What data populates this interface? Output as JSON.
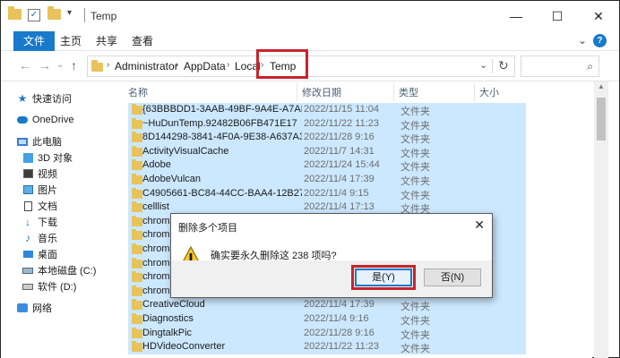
{
  "window": {
    "title": "Temp",
    "controls": {
      "minimize": "—",
      "maximize": "☐",
      "close": "✕"
    }
  },
  "ribbon": {
    "tabs": [
      "文件",
      "主页",
      "共享",
      "查看"
    ],
    "help": "?"
  },
  "nav": {
    "back": "←",
    "forward": "→",
    "dropdown": "⌄",
    "up": "↑",
    "breadcrumb": [
      "Administrator",
      "AppData",
      "Local",
      "Temp"
    ],
    "separator": "›",
    "search_placeholder": ""
  },
  "sidebar": {
    "items": [
      {
        "label": "快速访问",
        "icon": "star-icon"
      },
      {
        "label": "OneDrive",
        "icon": "cloud-icon"
      },
      {
        "label": "此电脑",
        "icon": "pc-icon"
      },
      {
        "label": "3D 对象",
        "icon": "cube-icon"
      },
      {
        "label": "视频",
        "icon": "video-icon"
      },
      {
        "label": "图片",
        "icon": "picture-icon"
      },
      {
        "label": "文档",
        "icon": "document-icon"
      },
      {
        "label": "下载",
        "icon": "download-icon"
      },
      {
        "label": "音乐",
        "icon": "music-icon"
      },
      {
        "label": "桌面",
        "icon": "desktop-icon"
      },
      {
        "label": "本地磁盘 (C:)",
        "icon": "drive-icon"
      },
      {
        "label": "软件 (D:)",
        "icon": "drive-icon"
      },
      {
        "label": "网络",
        "icon": "network-icon"
      }
    ]
  },
  "columns": {
    "name": "名称",
    "modified": "修改日期",
    "type": "类型",
    "size": "大小"
  },
  "files": [
    {
      "name": "{63BBBDD1-3AAB-49BF-9A4E-A7AE7...",
      "date": "2022/11/15 11:04",
      "type": "文件夹"
    },
    {
      "name": "~HuDunTemp.92482B06FB471E17",
      "date": "2022/11/22 11:23",
      "type": "文件夹"
    },
    {
      "name": "8D144298-3841-4F0A-9E38-A637A30...",
      "date": "2022/11/28 9:16",
      "type": "文件夹"
    },
    {
      "name": "ActivityVisualCache",
      "date": "2022/11/7 14:31",
      "type": "文件夹"
    },
    {
      "name": "Adobe",
      "date": "2022/11/24 15:44",
      "type": "文件夹"
    },
    {
      "name": "AdobeVulcan",
      "date": "2022/11/4 17:39",
      "type": "文件夹"
    },
    {
      "name": "C4905661-BC84-44CC-BAA4-12B276F...",
      "date": "2022/11/4 9:15",
      "type": "文件夹"
    },
    {
      "name": "celllist",
      "date": "2022/11/4 17:13",
      "type": "文件夹"
    },
    {
      "name": "chrome",
      "date": "",
      "type": ""
    },
    {
      "name": "chrome",
      "date": "",
      "type": ""
    },
    {
      "name": "chrome",
      "date": "",
      "type": ""
    },
    {
      "name": "chrome",
      "date": "",
      "type": ""
    },
    {
      "name": "chrome",
      "date": "",
      "type": ""
    },
    {
      "name": "chrome",
      "date": "",
      "type": ""
    },
    {
      "name": "CreativeCloud",
      "date": "2022/11/4 17:39",
      "type": "文件夹"
    },
    {
      "name": "Diagnostics",
      "date": "2022/11/4 9:16",
      "type": "文件夹"
    },
    {
      "name": "DingtalkPic",
      "date": "2022/11/28 9:16",
      "type": "文件夹"
    },
    {
      "name": "HDVideoConverter",
      "date": "2022/11/22 11:23",
      "type": "文件夹"
    }
  ],
  "dialog": {
    "title": "删除多个项目",
    "message": "确实要永久删除这 238 项吗?",
    "yes": "是(Y)",
    "no": "否(N)",
    "close": "✕"
  }
}
